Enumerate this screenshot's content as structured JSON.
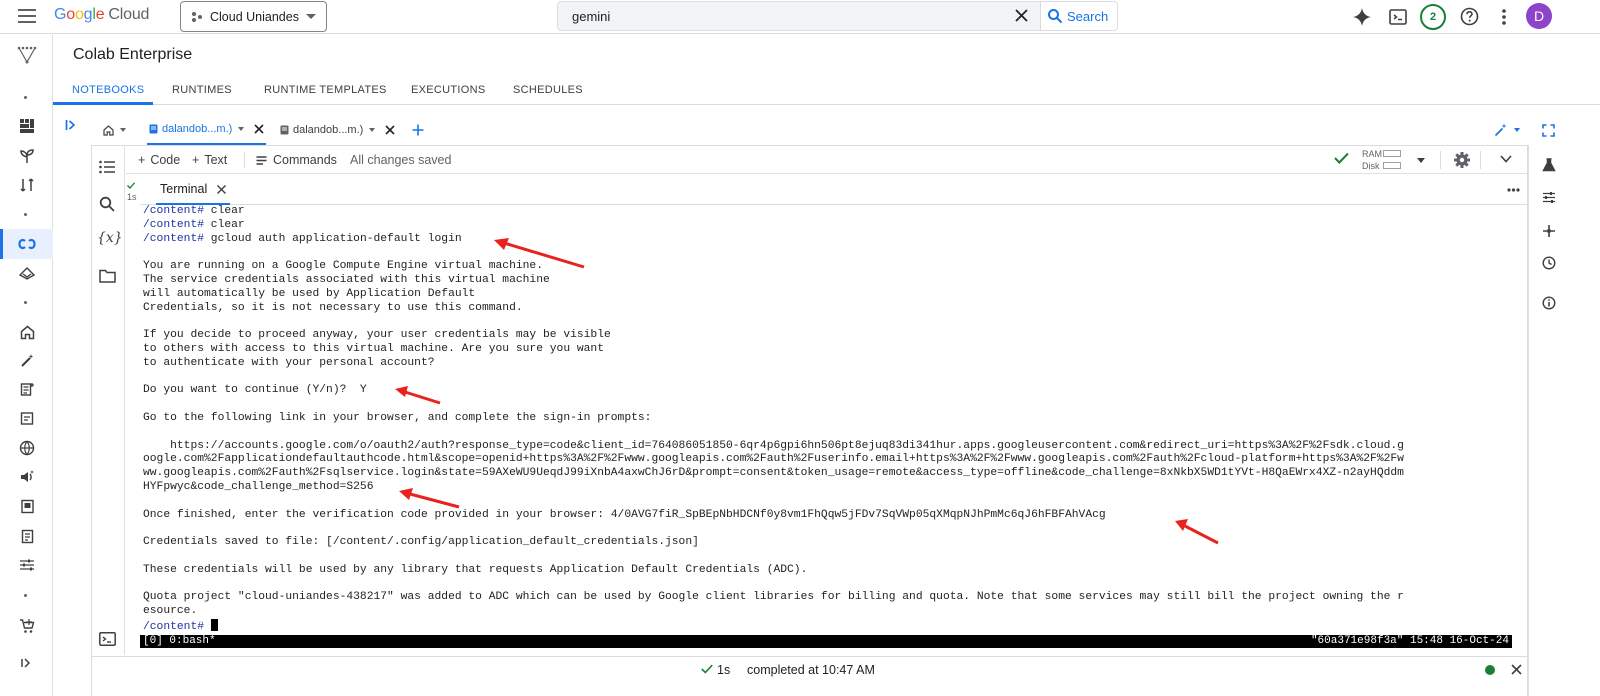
{
  "app": {
    "brand_google": "Google",
    "brand_cloud": "Cloud",
    "project_name": "Cloud Uniandes",
    "search_value": "gemini",
    "search_button": "Search",
    "notifications_count": "2",
    "avatar_initial": "D"
  },
  "page": {
    "title": "Colab Enterprise",
    "tabs": [
      {
        "label": "NOTEBOOKS"
      },
      {
        "label": "RUNTIMES"
      },
      {
        "label": "RUNTIME TEMPLATES"
      },
      {
        "label": "EXECUTIONS"
      },
      {
        "label": "SCHEDULES"
      }
    ]
  },
  "notebook": {
    "tabs": [
      {
        "label": "dalandob...m.)"
      },
      {
        "label": "dalandob...m.)"
      }
    ],
    "toolbar": {
      "code_label": "Code",
      "text_label": "Text",
      "commands_label": "Commands",
      "save_status": "All changes saved",
      "ram_label": "RAM",
      "disk_label": "Disk"
    },
    "exec_time": "1s",
    "terminal_tab_label": "Terminal"
  },
  "terminal": {
    "lines": [
      "/content# clear",
      "/content# clear",
      "/content# gcloud auth application-default login",
      "",
      "You are running on a Google Compute Engine virtual machine.",
      "The service credentials associated with this virtual machine",
      "will automatically be used by Application Default",
      "Credentials, so it is not necessary to use this command.",
      "",
      "If you decide to proceed anyway, your user credentials may be visible",
      "to others with access to this virtual machine. Are you sure you want",
      "to authenticate with your personal account?",
      "",
      "Do you want to continue (Y/n)?  Y",
      "",
      "Go to the following link in your browser, and complete the sign-in prompts:",
      "",
      "    https://accounts.google.com/o/oauth2/auth?response_type=code&client_id=764086051850-6qr4p6gpi6hn506pt8ejuq83di341hur.apps.googleusercontent.com&redirect_uri=https%3A%2F%2Fsdk.cloud.g",
      "oogle.com%2Fapplicationdefaultauthcode.html&scope=openid+https%3A%2F%2Fwww.googleapis.com%2Fauth%2Fuserinfo.email+https%3A%2F%2Fwww.googleapis.com%2Fauth%2Fcloud-platform+https%3A%2F%2Fw",
      "ww.googleapis.com%2Fauth%2Fsqlservice.login&state=59AXeWU9UeqdJ99iXnbA4axwChJ6rD&prompt=consent&token_usage=remote&access_type=offline&code_challenge=8xNkbX5WD1tYVt-H8QaEWrx4XZ-n2ayHQddm",
      "HYFpwyc&code_challenge_method=S256",
      "",
      "Once finished, enter the verification code provided in your browser: 4/0AVG7fiR_SpBEpNbHDCNf0y8vm1FhQqw5jFDv7SqVWp05qXMqpNJhPmMc6qJ6hFBFAhVAcg",
      "",
      "Credentials saved to file: [/content/.config/application_default_credentials.json]",
      "",
      "These credentials will be used by any library that requests Application Default Credentials (ADC).",
      "",
      "Quota project \"cloud-uniandes-438217\" was added to ADC which can be used by Google client libraries for billing and quota. Note that some services may still bill the project owning the r",
      "esource.",
      "/content# "
    ],
    "tmux_left": "[0] 0:bash*",
    "tmux_right": "\"60a371e98f3a\" 15:48 16-Oct-24"
  },
  "status": {
    "exec_time": "1s",
    "completed": "completed at 10:47 AM"
  },
  "colors": {
    "accent": "#1a73e8",
    "prompt": "#1c32a8",
    "annotation_arrow": "#e8231e",
    "success": "#188038"
  }
}
